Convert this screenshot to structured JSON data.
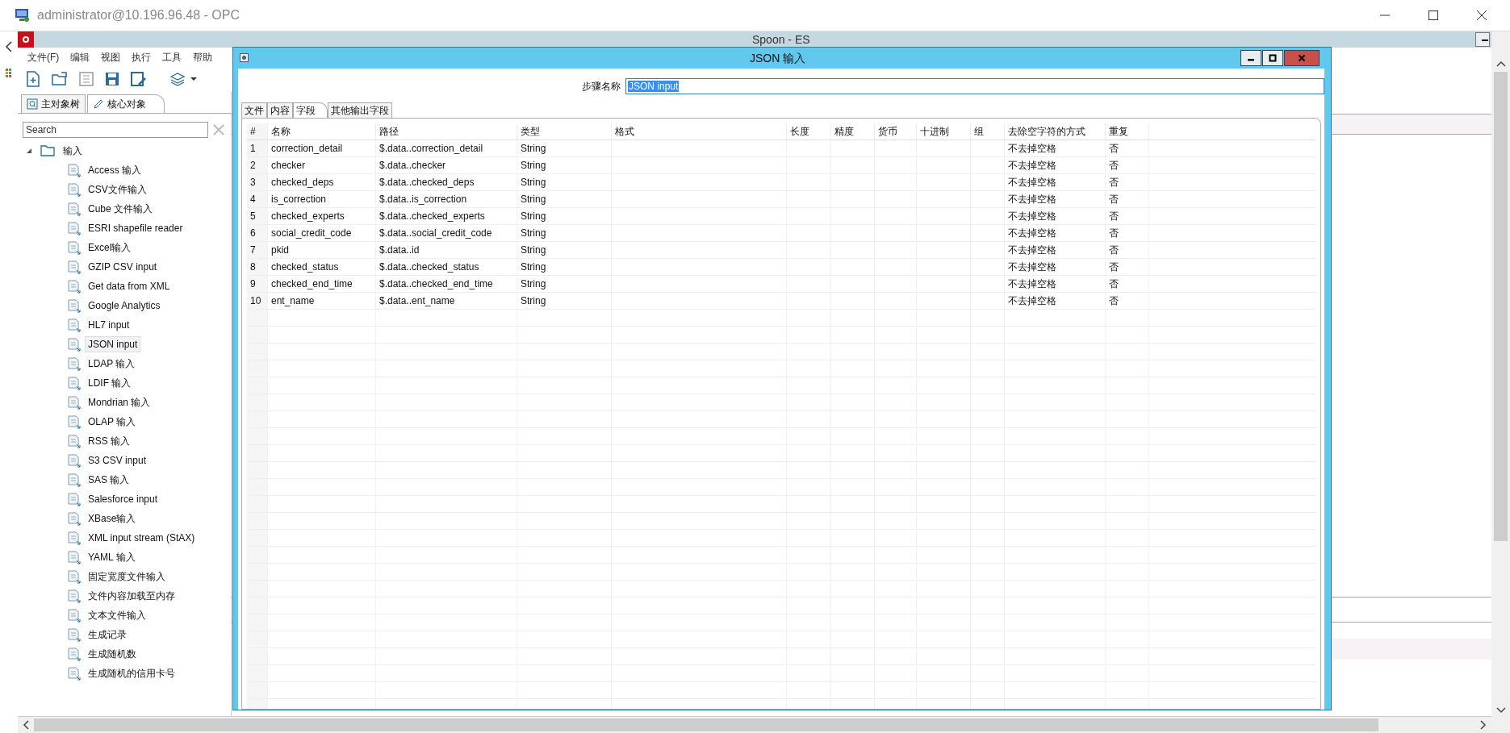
{
  "remote_window": {
    "title": "administrator@10.196.96.48 - OPC"
  },
  "spoon_window": {
    "title": "Spoon - ES"
  },
  "menu": [
    "文件(F)",
    "编辑",
    "视图",
    "执行",
    "工具",
    "帮助"
  ],
  "side_tabs": [
    {
      "label": "主对象树",
      "selected": false
    },
    {
      "label": "核心对象",
      "selected": true
    }
  ],
  "search": {
    "placeholder": "Search"
  },
  "tree": {
    "label": "输入",
    "expanded": true,
    "children": [
      {
        "label": "Access 输入",
        "selected": false
      },
      {
        "label": "CSV文件输入",
        "selected": false
      },
      {
        "label": "Cube 文件输入",
        "selected": false
      },
      {
        "label": "ESRI shapefile reader",
        "selected": false
      },
      {
        "label": "Excel输入",
        "selected": false
      },
      {
        "label": "GZIP CSV input",
        "selected": false
      },
      {
        "label": "Get data from XML",
        "selected": false
      },
      {
        "label": "Google Analytics",
        "selected": false
      },
      {
        "label": "HL7 input",
        "selected": false
      },
      {
        "label": "JSON input",
        "selected": true
      },
      {
        "label": "LDAP 输入",
        "selected": false
      },
      {
        "label": "LDIF 输入",
        "selected": false
      },
      {
        "label": "Mondrian 输入",
        "selected": false
      },
      {
        "label": "OLAP 输入",
        "selected": false
      },
      {
        "label": "RSS 输入",
        "selected": false
      },
      {
        "label": "S3 CSV input",
        "selected": false
      },
      {
        "label": "SAS 输入",
        "selected": false
      },
      {
        "label": "Salesforce input",
        "selected": false
      },
      {
        "label": "XBase输入",
        "selected": false
      },
      {
        "label": "XML input stream (StAX)",
        "selected": false
      },
      {
        "label": "YAML 输入",
        "selected": false
      },
      {
        "label": "固定宽度文件输入",
        "selected": false
      },
      {
        "label": "文件内容加载至内存",
        "selected": false
      },
      {
        "label": "文本文件输入",
        "selected": false
      },
      {
        "label": "生成记录",
        "selected": false
      },
      {
        "label": "生成随机数",
        "selected": false
      },
      {
        "label": "生成随机的信用卡号",
        "selected": false
      }
    ]
  },
  "dialog": {
    "title": "JSON 输入",
    "step_name_label": "步骤名称",
    "step_name": "JSON input",
    "step_name_highlighted": true,
    "tabs": [
      {
        "label": "文件",
        "selected": false
      },
      {
        "label": "内容",
        "selected": false
      },
      {
        "label": "字段",
        "selected": true
      },
      {
        "label": "其他输出字段",
        "selected": false
      }
    ],
    "table": {
      "columns": [
        "#",
        "名称",
        "路径",
        "类型",
        "格式",
        "长度",
        "精度",
        "货币",
        "十进制",
        "组",
        "去除空字符的方式",
        "重复"
      ],
      "rows": [
        {
          "num": "1",
          "name": "correction_detail",
          "path": "$.data..correction_detail",
          "type": "String",
          "trim_type": "不去掉空格",
          "repeat": "否"
        },
        {
          "num": "2",
          "name": "checker",
          "path": "$.data..checker",
          "type": "String",
          "trim_type": "不去掉空格",
          "repeat": "否"
        },
        {
          "num": "3",
          "name": "checked_deps",
          "path": "$.data..checked_deps",
          "type": "String",
          "trim_type": "不去掉空格",
          "repeat": "否"
        },
        {
          "num": "4",
          "name": "is_correction",
          "path": "$.data..is_correction",
          "type": "String",
          "trim_type": "不去掉空格",
          "repeat": "否"
        },
        {
          "num": "5",
          "name": "checked_experts",
          "path": "$.data..checked_experts",
          "type": "String",
          "trim_type": "不去掉空格",
          "repeat": "否"
        },
        {
          "num": "6",
          "name": "social_credit_code",
          "path": "$.data..social_credit_code",
          "type": "String",
          "trim_type": "不去掉空格",
          "repeat": "否"
        },
        {
          "num": "7",
          "name": "pkid",
          "path": "$.data..id",
          "type": "String",
          "trim_type": "不去掉空格",
          "repeat": "否"
        },
        {
          "num": "8",
          "name": "checked_status",
          "path": "$.data..checked_status",
          "type": "String",
          "trim_type": "不去掉空格",
          "repeat": "否"
        },
        {
          "num": "9",
          "name": "checked_end_time",
          "path": "$.data..checked_end_time",
          "type": "String",
          "trim_type": "不去掉空格",
          "repeat": "否"
        },
        {
          "num": "10",
          "name": "ent_name",
          "path": "$.data..ent_name",
          "type": "String",
          "trim_type": "不去掉空格",
          "repeat": "否"
        }
      ]
    }
  }
}
